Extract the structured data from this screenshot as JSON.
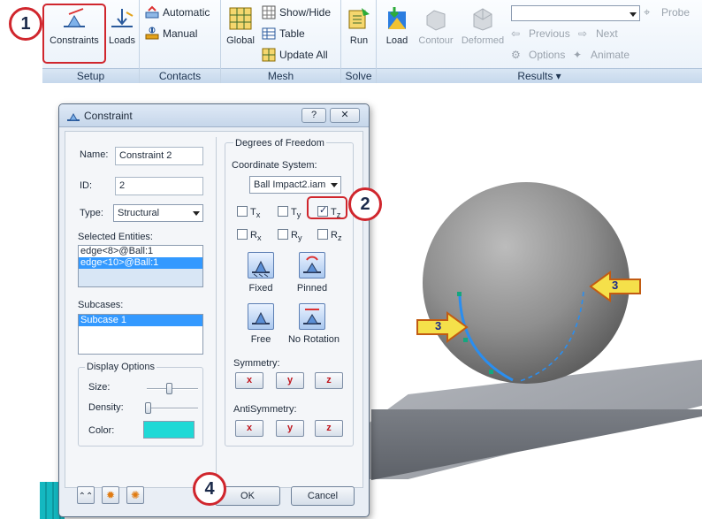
{
  "ribbon": {
    "setup": {
      "label": "Setup",
      "constraints": "Constraints",
      "loads": "Loads"
    },
    "contacts": {
      "label": "Contacts",
      "automatic": "Automatic",
      "manual": "Manual"
    },
    "mesh": {
      "label": "Mesh",
      "global": "Global",
      "show_hide": "Show/Hide",
      "table": "Table",
      "update_all": "Update  All"
    },
    "solve": {
      "label": "Solve",
      "run": "Run"
    },
    "results": {
      "label": "Results ▾",
      "load": "Load",
      "contour": "Contour",
      "deformed": "Deformed",
      "previous": "Previous",
      "next": "Next",
      "options": "Options",
      "animate": "Animate",
      "probe": "Probe",
      "combo_value": ""
    }
  },
  "dialog": {
    "title": "Constraint",
    "help": "?",
    "close": "✕",
    "name_label": "Name:",
    "name_value": "Constraint 2",
    "id_label": "ID:",
    "id_value": "2",
    "type_label": "Type:",
    "type_value": "Structural",
    "selected_label": "Selected Entities:",
    "selected_items": [
      "edge<8>@Ball:1",
      "edge<10>@Ball:1"
    ],
    "subcases_label": "Subcases:",
    "subcases_items": [
      "Subcase 1"
    ],
    "display_options": "Display Options",
    "size_label": "Size:",
    "density_label": "Density:",
    "color_label": "Color:",
    "color_value": "#1fd9d6",
    "dof_title": "Degrees of Freedom",
    "coord_label": "Coordinate System:",
    "coord_value": "Ball Impact2.iam",
    "dof": {
      "tx": {
        "base": "T",
        "sub": "x",
        "checked": false
      },
      "ty": {
        "base": "T",
        "sub": "y",
        "checked": false
      },
      "tz": {
        "base": "T",
        "sub": "z",
        "checked": true
      },
      "rx": {
        "base": "R",
        "sub": "x",
        "checked": false
      },
      "ry": {
        "base": "R",
        "sub": "y",
        "checked": false
      },
      "rz": {
        "base": "R",
        "sub": "z",
        "checked": false
      }
    },
    "presets": {
      "fixed": "Fixed",
      "pinned": "Pinned",
      "free": "Free",
      "no_rotation": "No Rotation"
    },
    "symmetry_label": "Symmetry:",
    "antisymmetry_label": "AntiSymmetry:",
    "axes": [
      "x",
      "y",
      "z"
    ],
    "ok": "OK",
    "cancel": "Cancel",
    "bottom_icons": [
      "expand-icon",
      "constraint-star-icon",
      "constraint-star-alt-icon"
    ]
  },
  "callouts": [
    "1",
    "2",
    "3",
    "3",
    "4"
  ],
  "colors": {
    "accent_red": "#d0262d",
    "selection_blue": "#3399ff",
    "constraint_edge": "#2a8ef0"
  }
}
